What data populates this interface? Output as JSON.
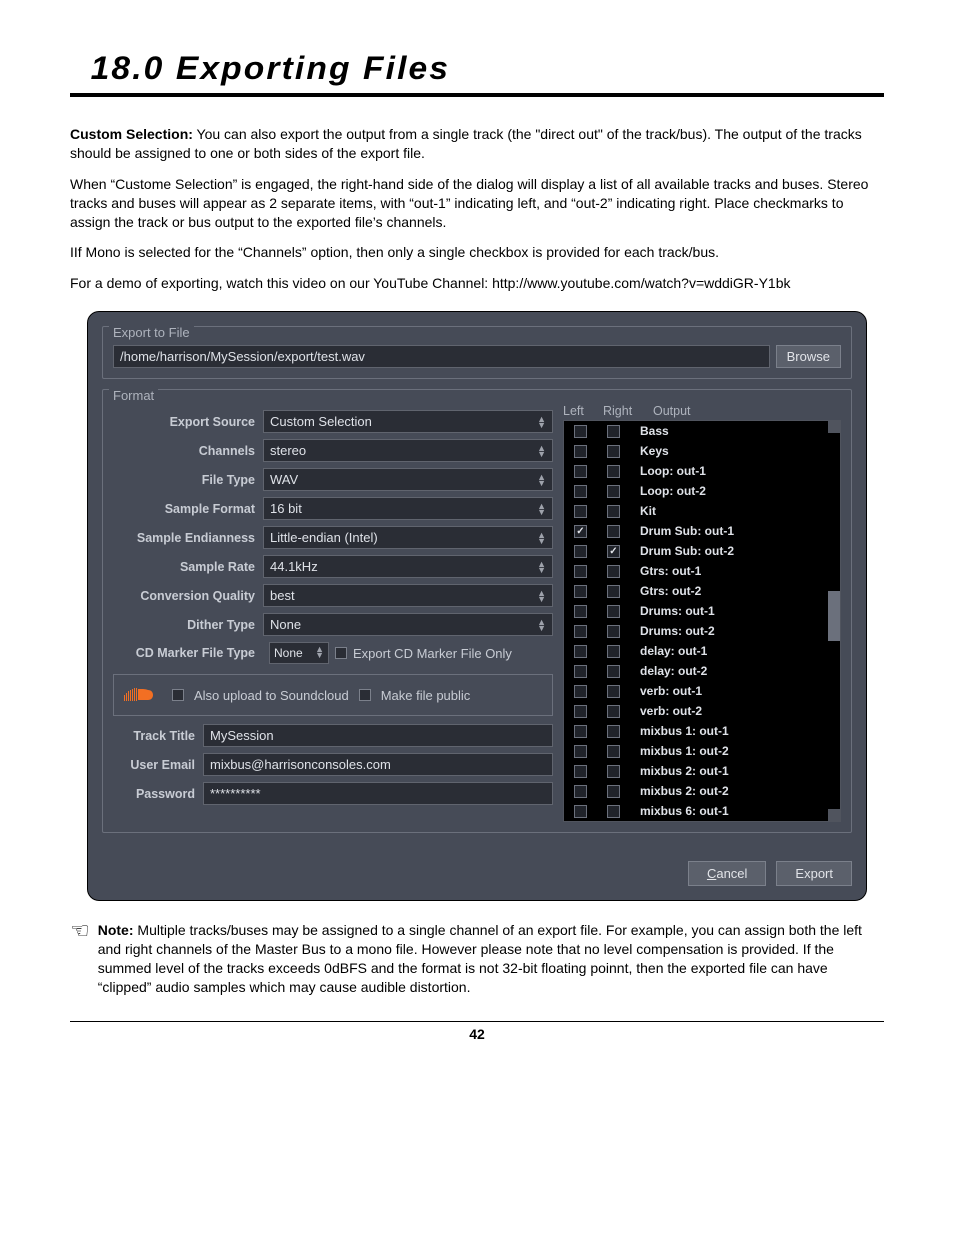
{
  "chapter_title": "18.0 Exporting Files",
  "p1_lead": "Custom Selection:",
  "p1_body": "  You can also export the output from a single track (the \"direct out\" of the track/bus).  The output of the tracks should be assigned to one or both sides of the export file.",
  "p2": "When “Custome Selection” is engaged, the right-hand side of the dialog will display a list of all available tracks and buses.  Stereo tracks and buses will appear as 2 separate items, with “out-1” indicating left, and “out-2” indicating right.  Place checkmarks to assign the track or bus output to the exported file’s channels.",
  "p3": "IIf Mono is selected for the “Channels” option, then only a single checkbox is provided for each track/bus.",
  "p4": "For a demo of exporting, watch this video on our YouTube Channel: http://www.youtube.com/watch?v=wddiGR-Y1bk",
  "dialog": {
    "group_export_label": "Export to File",
    "file_path": "/home/harrison/MySession/export/test.wav",
    "browse": "Browse",
    "group_format_label": "Format",
    "labels": {
      "export_source": "Export Source",
      "channels": "Channels",
      "file_type": "File Type",
      "sample_format": "Sample Format",
      "sample_endianness": "Sample Endianness",
      "sample_rate": "Sample Rate",
      "conversion_quality": "Conversion Quality",
      "dither_type": "Dither Type",
      "cd_marker_file_type": "CD Marker File Type",
      "track_title": "Track Title",
      "user_email": "User Email",
      "password": "Password"
    },
    "values": {
      "export_source": "Custom Selection",
      "channels": "stereo",
      "file_type": "WAV",
      "sample_format": "16 bit",
      "sample_endianness": "Little-endian (Intel)",
      "sample_rate": "44.1kHz",
      "conversion_quality": "best",
      "dither_type": "None",
      "cd_marker_file_type": "None",
      "track_title": "MySession",
      "user_email": "mixbus@harrisonconsoles.com",
      "password": "**********"
    },
    "export_cd_marker_only": "Export CD Marker File Only",
    "also_upload": "Also upload to Soundcloud",
    "make_public": "Make file public",
    "headers": {
      "left": "Left",
      "right": "Right",
      "output": "Output"
    },
    "outputs": [
      {
        "label": "Bass",
        "left": false,
        "right": false
      },
      {
        "label": "Keys",
        "left": false,
        "right": false
      },
      {
        "label": "Loop: out-1",
        "left": false,
        "right": false
      },
      {
        "label": "Loop: out-2",
        "left": false,
        "right": false
      },
      {
        "label": "Kit",
        "left": false,
        "right": false
      },
      {
        "label": "Drum Sub: out-1",
        "left": true,
        "right": false
      },
      {
        "label": "Drum Sub: out-2",
        "left": false,
        "right": true
      },
      {
        "label": "Gtrs: out-1",
        "left": false,
        "right": false
      },
      {
        "label": "Gtrs: out-2",
        "left": false,
        "right": false
      },
      {
        "label": "Drums: out-1",
        "left": false,
        "right": false
      },
      {
        "label": "Drums: out-2",
        "left": false,
        "right": false
      },
      {
        "label": "delay: out-1",
        "left": false,
        "right": false
      },
      {
        "label": "delay: out-2",
        "left": false,
        "right": false
      },
      {
        "label": "verb: out-1",
        "left": false,
        "right": false
      },
      {
        "label": "verb: out-2",
        "left": false,
        "right": false
      },
      {
        "label": "mixbus 1: out-1",
        "left": false,
        "right": false
      },
      {
        "label": "mixbus 1: out-2",
        "left": false,
        "right": false
      },
      {
        "label": "mixbus 2: out-1",
        "left": false,
        "right": false
      },
      {
        "label": "mixbus 2: out-2",
        "left": false,
        "right": false
      },
      {
        "label": "mixbus 6: out-1",
        "left": false,
        "right": false
      }
    ],
    "cancel": "Cancel",
    "export": "Export"
  },
  "note_lead": "Note:",
  "note_body": "  Multiple tracks/buses may be assigned to a single channel of an export file.  For example, you can assign both the left and right channels of the Master Bus to a mono file.  However please note that no level compensation is provided. If the summed level of the tracks exceeds 0dBFS and the format is not 32-bit floating poinnt, then the exported file can have “clipped” audio samples which may cause audible distortion.",
  "page_number": "42"
}
